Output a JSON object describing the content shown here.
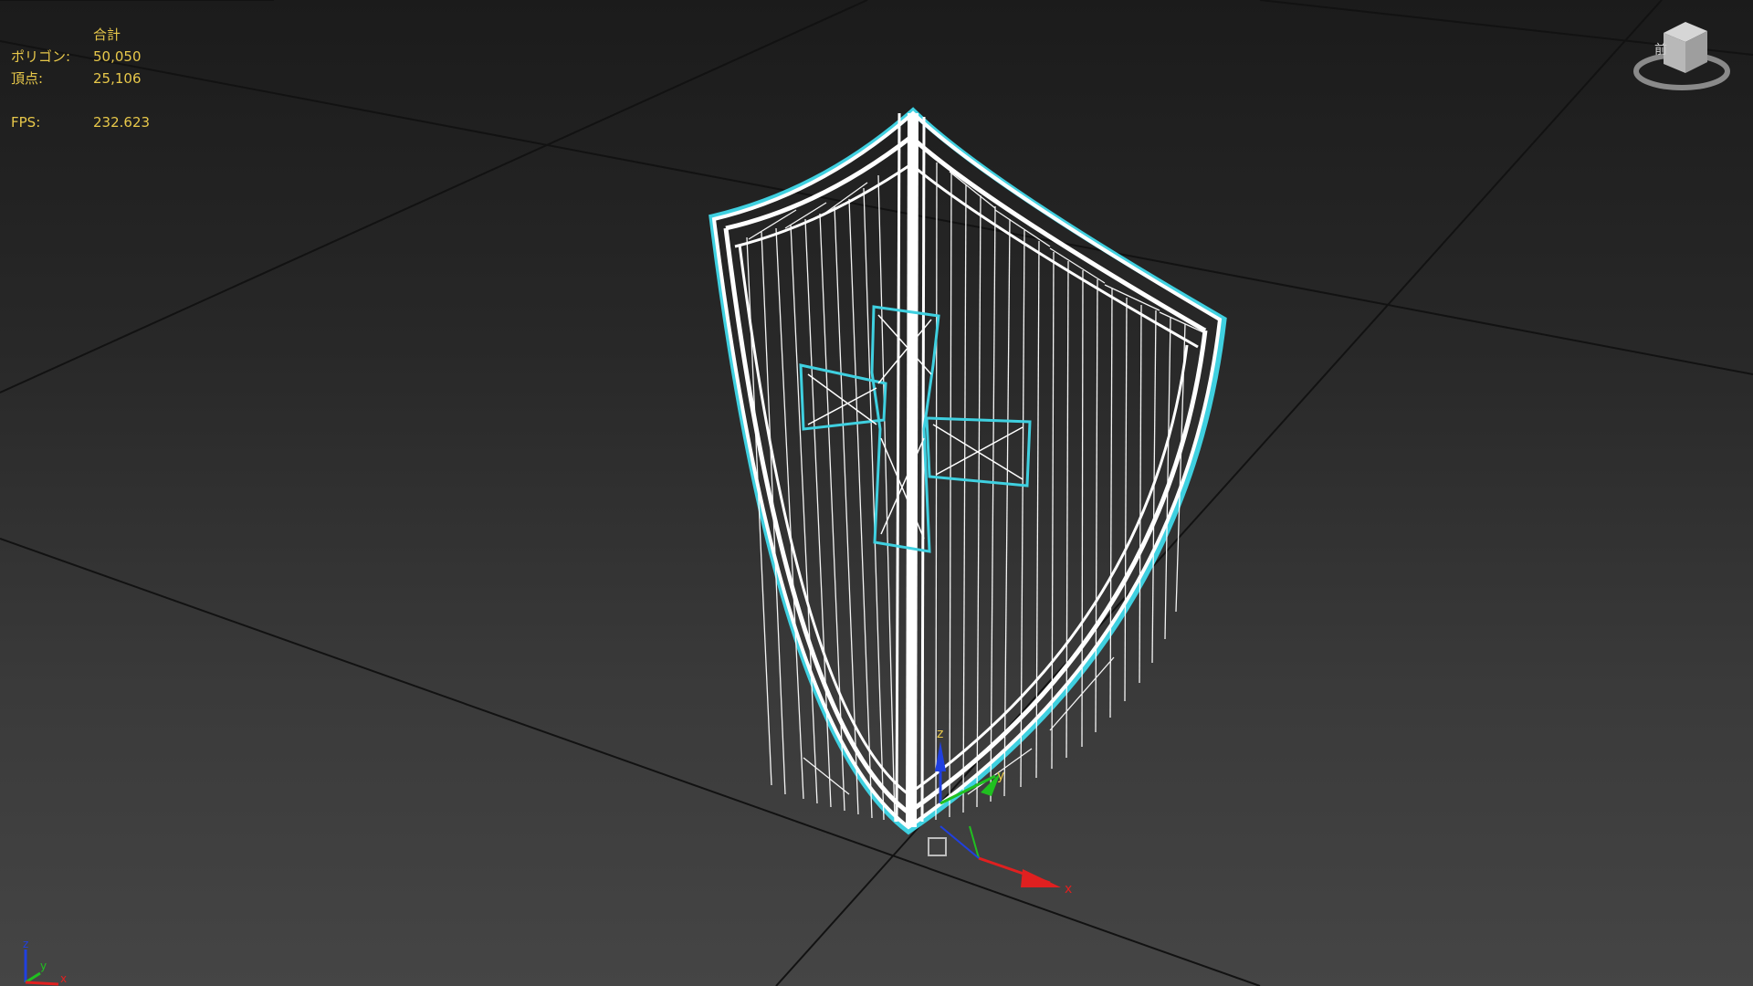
{
  "viewport": {
    "stats": {
      "header": "合計",
      "rows": [
        {
          "label": "ポリゴン:",
          "value": "50,050"
        },
        {
          "label": "頂点:",
          "value": "25,106"
        },
        {
          "label": "FPS:",
          "value": "232.623"
        }
      ]
    },
    "viewcube": {
      "face_label": "前"
    },
    "gizmo": {
      "x_label": "x",
      "y_label": "y",
      "z_label": "z"
    },
    "corner_axis": {
      "x_label": "x",
      "y_label": "y",
      "z_label": "z"
    },
    "colors": {
      "stats_text": "#e8c84a",
      "wire": "#ffffff",
      "selection_outline": "#3fd0e0",
      "grid": "#121212",
      "axis_x": "#e02020",
      "axis_y": "#20c020",
      "axis_z": "#2040e0"
    },
    "icons": [
      "viewcube-icon",
      "transform-gizmo-icon",
      "axis-tripod-icon",
      "pivot-box-icon"
    ]
  }
}
